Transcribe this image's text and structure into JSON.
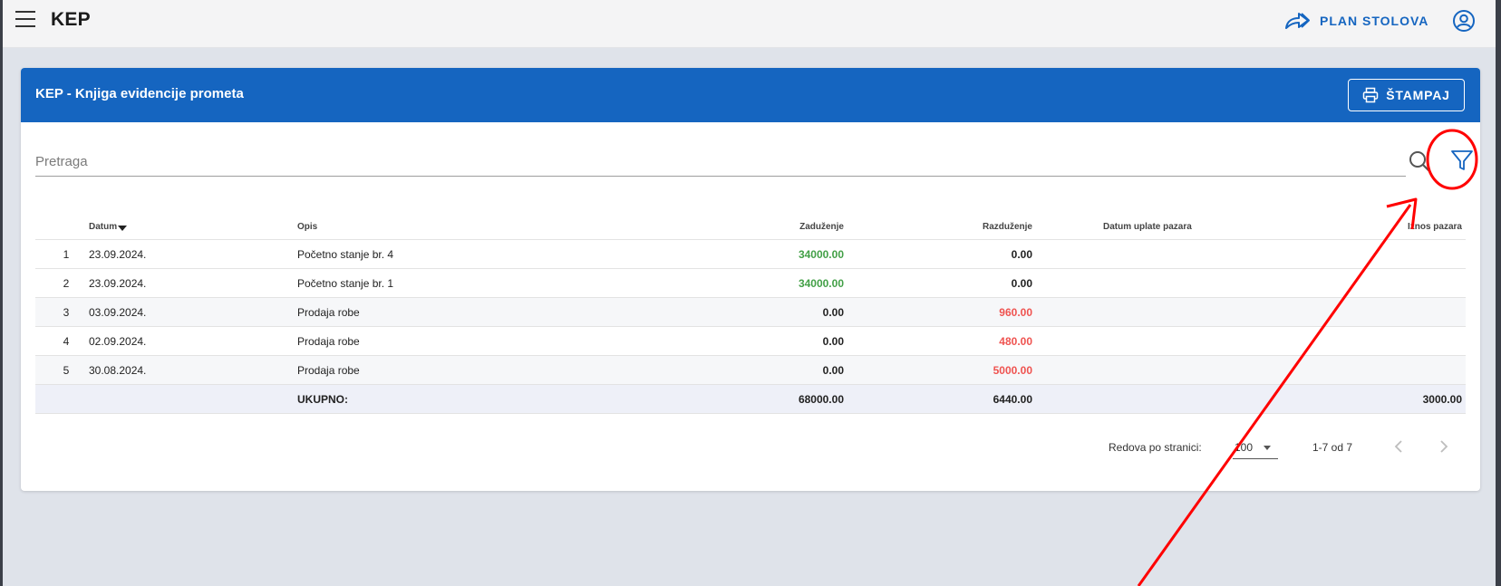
{
  "app": {
    "title": "KEP",
    "plan_label": "PLAN STOLOVA"
  },
  "card": {
    "title": "KEP - Knjiga evidencije prometa",
    "print_label": "ŠTAMPAJ"
  },
  "search": {
    "placeholder": "Pretraga",
    "value": ""
  },
  "table": {
    "headers": {
      "datum": "Datum",
      "opis": "Opis",
      "zaduzenje": "Zaduženje",
      "razduzenje": "Razduženje",
      "datum_uplate": "Datum uplate pazara",
      "iznos": "Iznos pazara"
    },
    "rows": [
      {
        "idx": "1",
        "datum": "23.09.2024.",
        "opis": "Početno stanje br. 4",
        "zaduzenje": "34000.00",
        "razduzenje": "0.00"
      },
      {
        "idx": "2",
        "datum": "23.09.2024.",
        "opis": "Početno stanje br. 1",
        "zaduzenje": "34000.00",
        "razduzenje": "0.00"
      },
      {
        "idx": "3",
        "datum": "03.09.2024.",
        "opis": "Prodaja robe",
        "zaduzenje": "0.00",
        "razduzenje": "960.00"
      },
      {
        "idx": "4",
        "datum": "02.09.2024.",
        "opis": "Prodaja robe",
        "zaduzenje": "0.00",
        "razduzenje": "480.00"
      },
      {
        "idx": "5",
        "datum": "30.08.2024.",
        "opis": "Prodaja robe",
        "zaduzenje": "0.00",
        "razduzenje": "5000.00"
      }
    ],
    "total": {
      "label": "UKUPNO:",
      "zaduzenje": "68000.00",
      "razduzenje": "6440.00",
      "iznos": "3000.00"
    }
  },
  "pagination": {
    "rows_label": "Redova po stranici:",
    "rows_per_page": "100",
    "range": "1-7 od 7"
  },
  "colors": {
    "primary": "#1565c0",
    "positive": "#43a047",
    "negative": "#ef5350",
    "annotation": "#ff0000"
  },
  "icons": {
    "menu": "menu-icon",
    "plan": "share-arrow-icon",
    "account": "account-circle-icon",
    "print": "printer-icon",
    "search": "search-icon",
    "filter": "filter-icon",
    "prev": "chevron-left-icon",
    "next": "chevron-right-icon"
  }
}
